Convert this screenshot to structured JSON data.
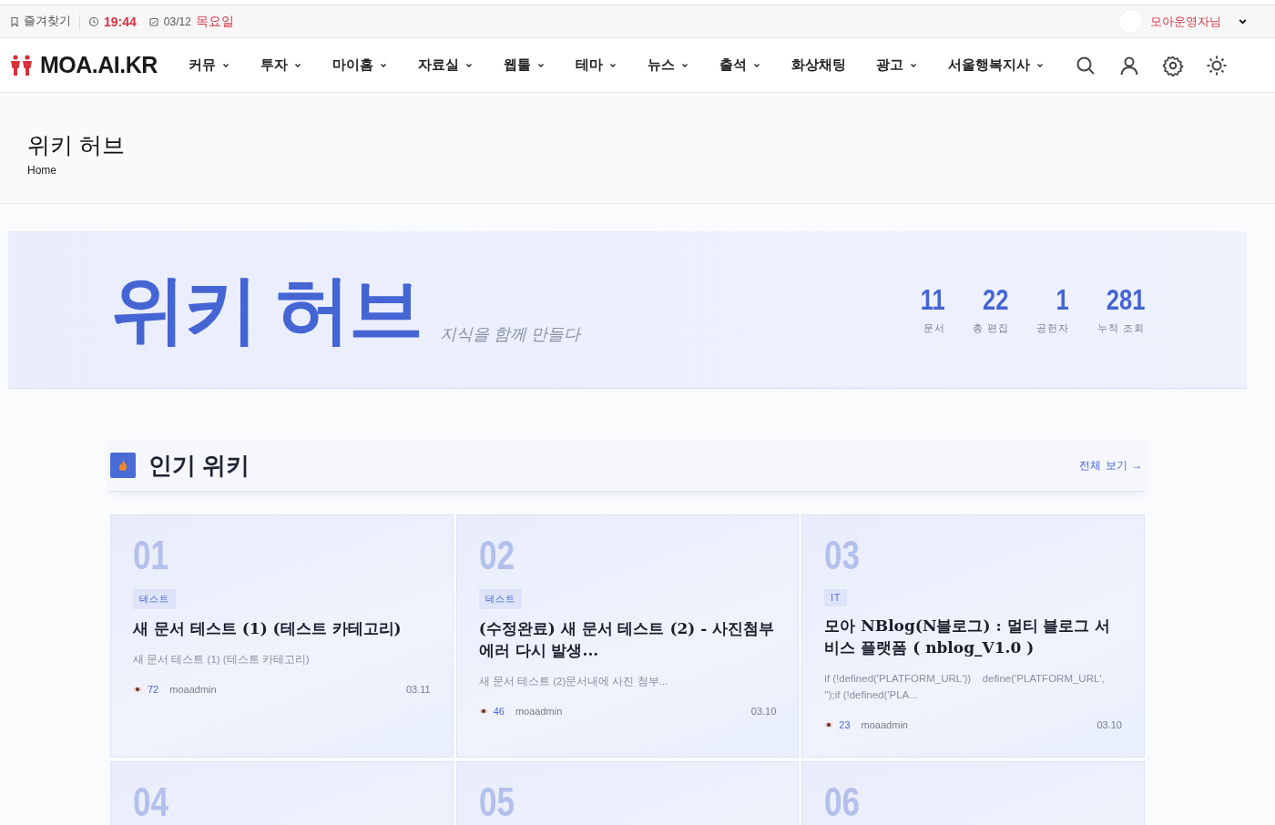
{
  "topbar": {
    "bookmark": "즐겨찾기",
    "time": "19:44",
    "date": "03/12",
    "weekday": "목요일",
    "user": "모아운영자님"
  },
  "logo": "MOA.AI.KR",
  "nav": [
    {
      "label": "커뮤",
      "dropdown": true
    },
    {
      "label": "투자",
      "dropdown": true
    },
    {
      "label": "마이홈",
      "dropdown": true
    },
    {
      "label": "자료실",
      "dropdown": true
    },
    {
      "label": "웹툴",
      "dropdown": true
    },
    {
      "label": "테마",
      "dropdown": true
    },
    {
      "label": "뉴스",
      "dropdown": true
    },
    {
      "label": "출석",
      "dropdown": true
    },
    {
      "label": "화상채팅",
      "dropdown": false
    },
    {
      "label": "광고",
      "dropdown": true
    },
    {
      "label": "서울행복지사",
      "dropdown": true
    }
  ],
  "page_header": {
    "title": "위키 허브",
    "breadcrumb": "Home"
  },
  "hero": {
    "title": "위키 허브",
    "subtitle": "지식을 함께 만들다",
    "stats": [
      {
        "value": "11",
        "label": "문서"
      },
      {
        "value": "22",
        "label": "총 편집"
      },
      {
        "value": "1",
        "label": "공헌자"
      },
      {
        "value": "281",
        "label": "누적 조회"
      }
    ]
  },
  "popular": {
    "title": "인기 위키",
    "view_all": "전체 보기 →",
    "cards": [
      {
        "rank": "01",
        "tag": "테스트",
        "title": "새 문서 테스트 (1) (테스트 카테고리)",
        "excerpt": "새 문서 테스트 (1) (테스트 카테고리)",
        "views": "72",
        "author": "moaadmin",
        "date": "03.11"
      },
      {
        "rank": "02",
        "tag": "테스트",
        "title": "(수정완료) 새 문서 테스트 (2) - 사진첨부 에러 다시 발생...",
        "excerpt": "새 문서 테스트 (2)문서내에 사진 첨부...",
        "views": "46",
        "author": "moaadmin",
        "date": "03.10"
      },
      {
        "rank": "03",
        "tag": "IT",
        "title": "모아 NBlog(N블로그) : 멀티 블로그 서비스 플랫폼 ( nblog_V1.0 )",
        "excerpt": "if (!defined('PLATFORM_URL'))    define('PLATFORM_URL', '');if (!defined('PLA...",
        "views": "23",
        "author": "moaadmin",
        "date": "03.10"
      },
      {
        "rank": "04"
      },
      {
        "rank": "05"
      },
      {
        "rank": "06"
      }
    ]
  }
}
